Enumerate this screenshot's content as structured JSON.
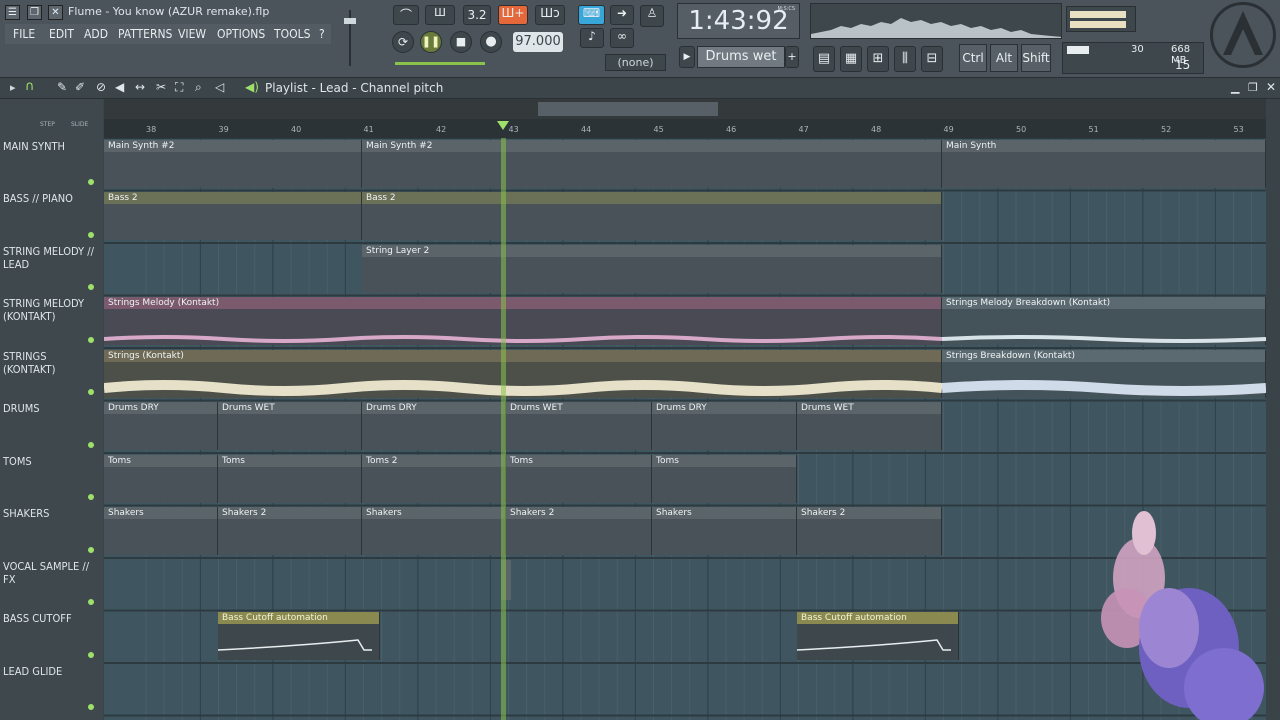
{
  "window": {
    "title": "Flume - You know (AZUR remake).flp"
  },
  "menu": [
    "FILE",
    "EDIT",
    "ADD",
    "PATTERNS",
    "VIEW",
    "OPTIONS",
    "TOOLS",
    "?"
  ],
  "transport": {
    "pattern_label": "3.2",
    "tempo": "97.000",
    "time": "1:43:92",
    "time_unit": "M:S:CS",
    "pattern_select": "(none)"
  },
  "hint": {
    "text": "Drums wet"
  },
  "modifiers": [
    "Ctrl",
    "Alt",
    "Shift"
  ],
  "cpu": {
    "value": "30",
    "memory": "668 MB",
    "polyphony": "15"
  },
  "playlist": {
    "title": "Playlist - Lead - Channel pitch",
    "step_label": "STEP",
    "slide_label": "SLIDE"
  },
  "ruler": [
    "38",
    "39",
    "40",
    "41",
    "42",
    "43",
    "44",
    "45",
    "46",
    "47",
    "48",
    "49",
    "50",
    "51",
    "52",
    "53"
  ],
  "tracks": [
    {
      "name": "MAIN SYNTH"
    },
    {
      "name": "BASS // PIANO"
    },
    {
      "name": "STRING MELODY // LEAD"
    },
    {
      "name": "STRING MELODY (KONTAKT)"
    },
    {
      "name": "STRINGS (KONTAKT)"
    },
    {
      "name": "DRUMS"
    },
    {
      "name": "TOMS"
    },
    {
      "name": "SHAKERS"
    },
    {
      "name": "VOCAL SAMPLE // FX"
    },
    {
      "name": "BASS CUTOFF"
    },
    {
      "name": "LEAD GLIDE"
    }
  ],
  "clips": {
    "main": [
      "Main Synth #2",
      "Main Synth #2",
      "Main Synth"
    ],
    "bass": [
      "Bass 2",
      "Bass 2"
    ],
    "lead": [
      "String Layer 2"
    ],
    "smk": [
      "Strings Melody (Kontakt)",
      "Strings Melody Breakdown (Kontakt)"
    ],
    "sk": [
      "Strings (Kontakt)",
      "Strings Breakdown (Kontakt)"
    ],
    "drums": [
      "Drums DRY",
      "Drums WET",
      "Drums DRY",
      "Drums WET",
      "Drums DRY",
      "Drums WET"
    ],
    "toms": [
      "Toms",
      "Toms",
      "Toms 2",
      "Toms",
      "Toms"
    ],
    "shakers": [
      "Shakers",
      "Shakers 2",
      "Shakers",
      "Shakers 2",
      "Shakers",
      "Shakers 2"
    ],
    "cutoff": [
      "Bass Cutoff automation",
      "Bass Cutoff automation"
    ]
  }
}
